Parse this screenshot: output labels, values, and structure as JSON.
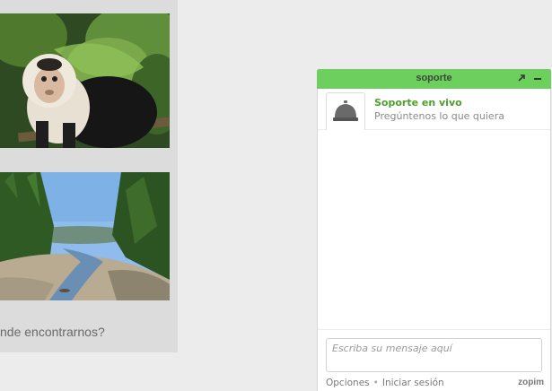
{
  "content": {
    "photos": [
      {
        "subject": "white-faced capuchin monkey"
      },
      {
        "subject": "tropical beach estuary"
      }
    ],
    "question_text": "nde encontrarnos?"
  },
  "chat": {
    "title": "soporte",
    "header_buttons": [
      "popout-icon",
      "minimize-icon"
    ],
    "agent": {
      "name": "Soporte en vivo",
      "tagline": "Pregúntenos lo que quiera",
      "avatar_icon": "service-bell-icon"
    },
    "input": {
      "value": "",
      "placeholder": "Escriba su mensaje aquí"
    },
    "footer": {
      "options_label": "Opciones",
      "separator": "•",
      "login_label": "Iniciar sesión",
      "brand": "zopim"
    },
    "colors": {
      "header": "#6dcf5d",
      "agent_name": "#4e9e2f"
    }
  }
}
